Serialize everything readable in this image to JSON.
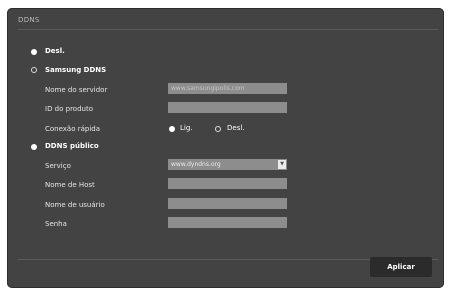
{
  "title": "DDNS",
  "options": {
    "off": {
      "label": "Desl.",
      "selected": true
    },
    "samsung": {
      "label": "Samsung DDNS",
      "selected": false
    },
    "public": {
      "label": "DDNS público",
      "selected": true
    }
  },
  "samsung_fields": {
    "server_label": "Nome do servidor",
    "server_value": "www.samsungipolis.com",
    "product_id_label": "ID do produto",
    "product_id_value": "",
    "quick_connect_label": "Conexão rápida",
    "quick_on_label": "Lig.",
    "quick_off_label": "Desl."
  },
  "public_fields": {
    "service_label": "Serviço",
    "service_value": "www.dyndns.org",
    "host_label": "Nome de Host",
    "host_value": "",
    "user_label": "Nome de usuário",
    "user_value": "",
    "password_label": "Senha",
    "password_value": ""
  },
  "apply_label": "Aplicar"
}
